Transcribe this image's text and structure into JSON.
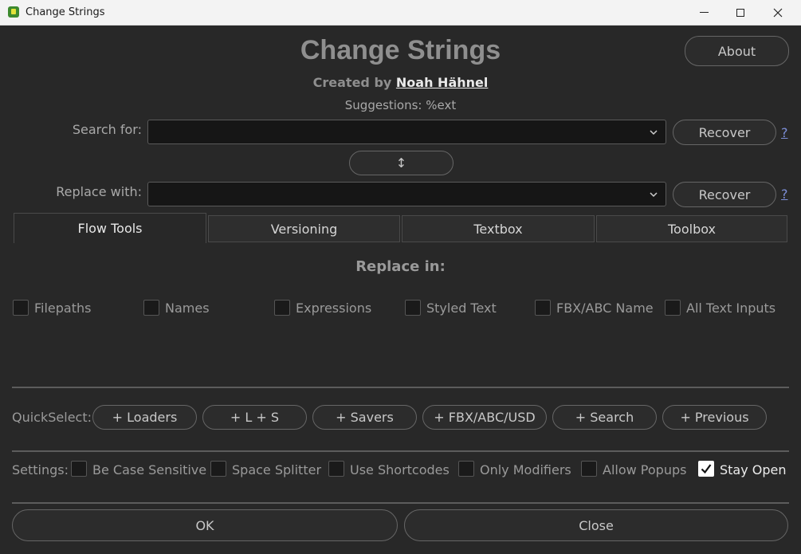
{
  "window": {
    "title": "Change Strings"
  },
  "header": {
    "title": "Change Strings",
    "created_by_prefix": "Created by",
    "author": "Noah Hähnel",
    "suggestions": "Suggestions: %ext",
    "about_label": "About"
  },
  "search": {
    "label": "Search for:",
    "value": "",
    "recover_label": "Recover",
    "help": "?"
  },
  "swap": {
    "icon": "↕"
  },
  "replace": {
    "label": "Replace with:",
    "value": "",
    "recover_label": "Recover",
    "help": "?"
  },
  "tabs": [
    {
      "label": "Flow Tools",
      "active": true
    },
    {
      "label": "Versioning",
      "active": false
    },
    {
      "label": "Textbox",
      "active": false
    },
    {
      "label": "Toolbox",
      "active": false
    }
  ],
  "replace_in": {
    "title": "Replace in:",
    "options": [
      {
        "label": "Filepaths",
        "checked": false
      },
      {
        "label": "Names",
        "checked": false
      },
      {
        "label": "Expressions",
        "checked": false
      },
      {
        "label": "Styled Text",
        "checked": false
      },
      {
        "label": "FBX/ABC Name",
        "checked": false
      },
      {
        "label": "All Text Inputs",
        "checked": false
      }
    ]
  },
  "quickselect": {
    "label": "QuickSelect:",
    "buttons": [
      "+ Loaders",
      "+ L + S",
      "+ Savers",
      "+ FBX/ABC/USD",
      "+ Search",
      "+ Previous"
    ]
  },
  "settings": {
    "label": "Settings:",
    "options": [
      {
        "label": "Be Case Sensitive",
        "checked": false
      },
      {
        "label": "Space Splitter",
        "checked": false
      },
      {
        "label": "Use Shortcodes",
        "checked": false
      },
      {
        "label": "Only Modifiers",
        "checked": false
      },
      {
        "label": "Allow Popups",
        "checked": false
      },
      {
        "label": "Stay Open",
        "checked": true
      }
    ]
  },
  "footer": {
    "ok_label": "OK",
    "close_label": "Close"
  },
  "icons": {
    "app": "fusion-app-icon",
    "chevron": "chevron-down-icon",
    "swap": "swap-vertical-icon"
  }
}
